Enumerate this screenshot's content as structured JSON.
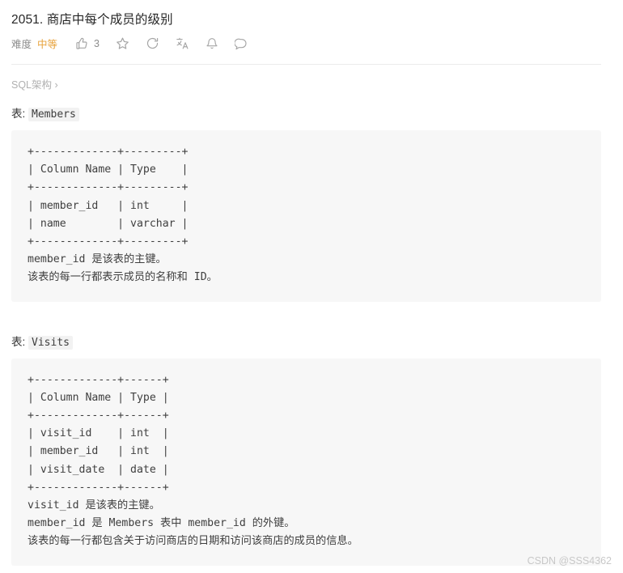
{
  "header": {
    "title": "2051. 商店中每个成员的级别",
    "difficulty_label": "难度",
    "difficulty_value": "中等",
    "like_count": "3",
    "icons": [
      "thumbs-up-icon",
      "star-icon",
      "refresh-icon",
      "translate-icon",
      "bell-icon",
      "comment-icon"
    ]
  },
  "breadcrumb": {
    "text": "SQL架构 ›"
  },
  "tables": [
    {
      "label_prefix": "表: ",
      "name": "Members",
      "code": "+-------------+---------+\n| Column Name | Type    |\n+-------------+---------+\n| member_id   | int     |\n| name        | varchar |\n+-------------+---------+\nmember_id 是该表的主键。\n该表的每一行都表示成员的名称和 ID。"
    },
    {
      "label_prefix": "表: ",
      "name": "Visits",
      "code": "+-------------+------+\n| Column Name | Type |\n+-------------+------+\n| visit_id    | int  |\n| member_id   | int  |\n| visit_date  | date |\n+-------------+------+\nvisit_id 是该表的主键。\nmember_id 是 Members 表中 member_id 的外键。\n该表的每一行都包含关于访问商店的日期和访问该商店的成员的信息。"
    }
  ],
  "footer": {
    "watermark": "CSDN @SSS4362"
  }
}
